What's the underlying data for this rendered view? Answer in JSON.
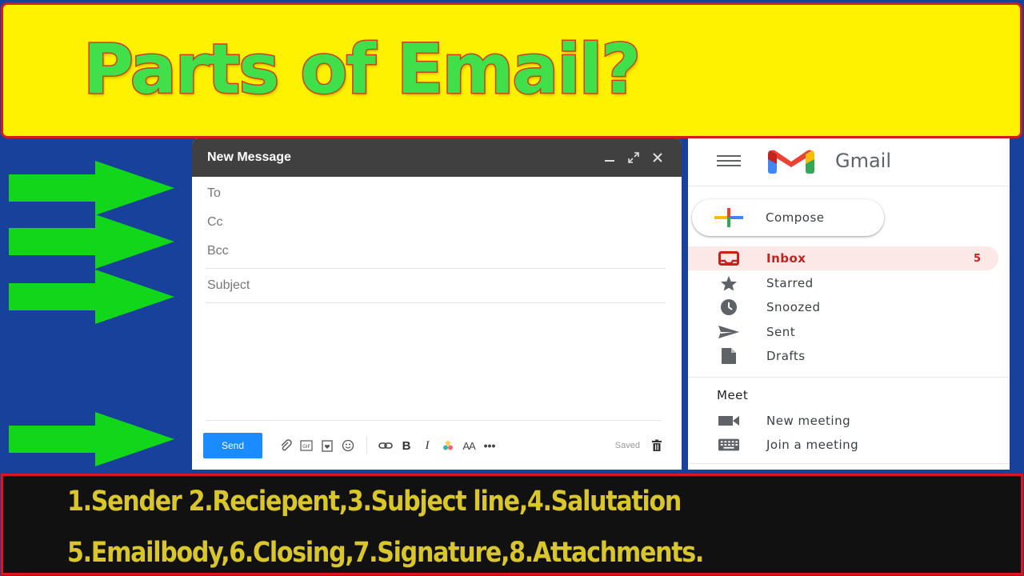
{
  "banner": {
    "title": "Parts of Email?"
  },
  "colors": {
    "background": "#17419a",
    "banner_bg": "#fff200",
    "banner_text": "#3fe04a",
    "banner_outline": "#d8391c",
    "arrow": "#12d61a",
    "bottom_bg": "#111111",
    "bottom_text": "#d8c62c",
    "send_button": "#1a8cff",
    "inbox_active": "#c5221f"
  },
  "arrows": [
    {
      "name": "arrow-to-field"
    },
    {
      "name": "arrow-cc-field"
    },
    {
      "name": "arrow-subject-field"
    },
    {
      "name": "arrow-send-toolbar"
    }
  ],
  "compose": {
    "title": "New Message",
    "header_icons": [
      "minimize-icon",
      "expand-icon",
      "close-icon"
    ],
    "fields": {
      "to": "To",
      "cc": "Cc",
      "bcc": "Bcc",
      "subject": "Subject"
    },
    "toolbar": {
      "send_label": "Send",
      "icons": [
        "attach-icon",
        "gif-icon",
        "sticker-icon",
        "emoji-icon",
        "link-icon",
        "bold-icon",
        "italic-icon",
        "text-color-icon",
        "font-size-icon",
        "more-options-icon"
      ],
      "saved_label": "Saved",
      "delete_icon": "trash-icon"
    }
  },
  "gmail": {
    "app_name": "Gmail",
    "compose_label": "Compose",
    "nav": [
      {
        "label": "Inbox",
        "icon": "inbox-icon",
        "count": "5",
        "active": true
      },
      {
        "label": "Starred",
        "icon": "star-icon"
      },
      {
        "label": "Snoozed",
        "icon": "clock-icon"
      },
      {
        "label": "Sent",
        "icon": "send-icon"
      },
      {
        "label": "Drafts",
        "icon": "draft-icon"
      }
    ],
    "meet": {
      "title": "Meet",
      "items": [
        {
          "label": "New meeting",
          "icon": "video-camera-icon"
        },
        {
          "label": "Join a meeting",
          "icon": "keyboard-icon"
        }
      ]
    }
  },
  "bottom": {
    "line1": "1.Sender 2.Reciepent,3.Subject line,4.Salutation",
    "line2": "5.Emailbody,6.Closing,7.Signature,8.Attachments."
  }
}
